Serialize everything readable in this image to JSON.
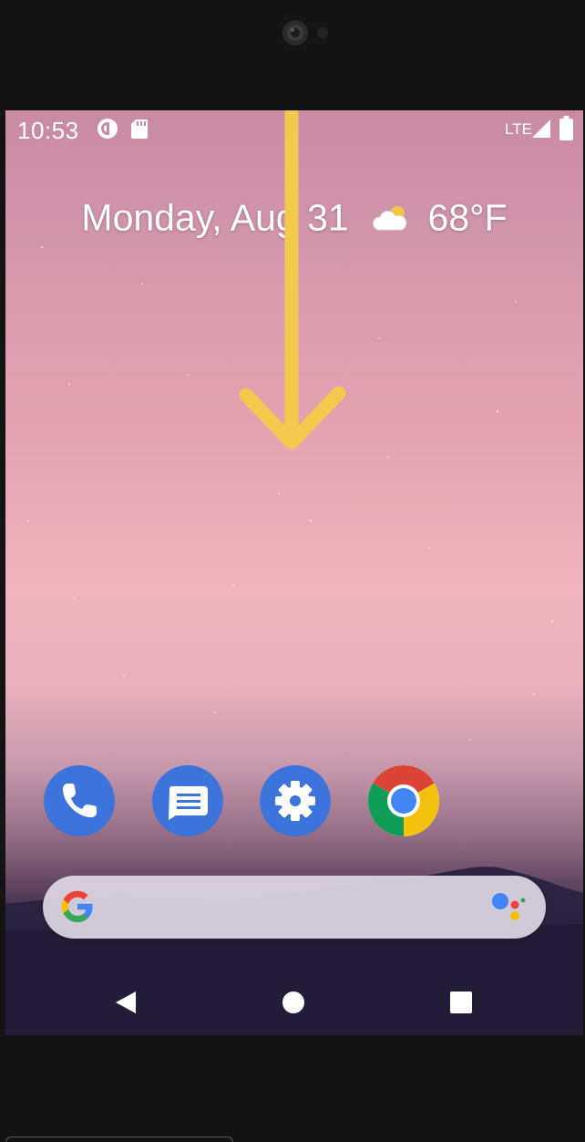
{
  "status_bar": {
    "time": "10:53",
    "network": "LTE",
    "notification_icons": [
      "pocket-casts-icon",
      "sd-card-icon"
    ],
    "signal_icon": "cell-signal-icon",
    "battery_icon": "battery-icon"
  },
  "glance": {
    "date": "Monday, Aug 31",
    "weather_icon": "partly-cloudy-icon",
    "temperature": "68°F"
  },
  "overlay": {
    "icon": "swipe-down-arrow",
    "color": "#f2c94c"
  },
  "dock": {
    "apps": [
      {
        "icon": "phone-icon",
        "color": "#3d74dc"
      },
      {
        "icon": "messages-icon",
        "color": "#3d74dc"
      },
      {
        "icon": "settings-icon",
        "color": "#3d74dc"
      },
      {
        "icon": "chrome-icon",
        "color": "#4285f4"
      }
    ]
  },
  "search_bar": {
    "logo_icon": "google-g-icon",
    "assistant_icon": "google-assistant-icon"
  },
  "nav_bar": {
    "back_icon": "back-triangle-icon",
    "home_icon": "home-circle-icon",
    "recents_icon": "recents-square-icon"
  }
}
